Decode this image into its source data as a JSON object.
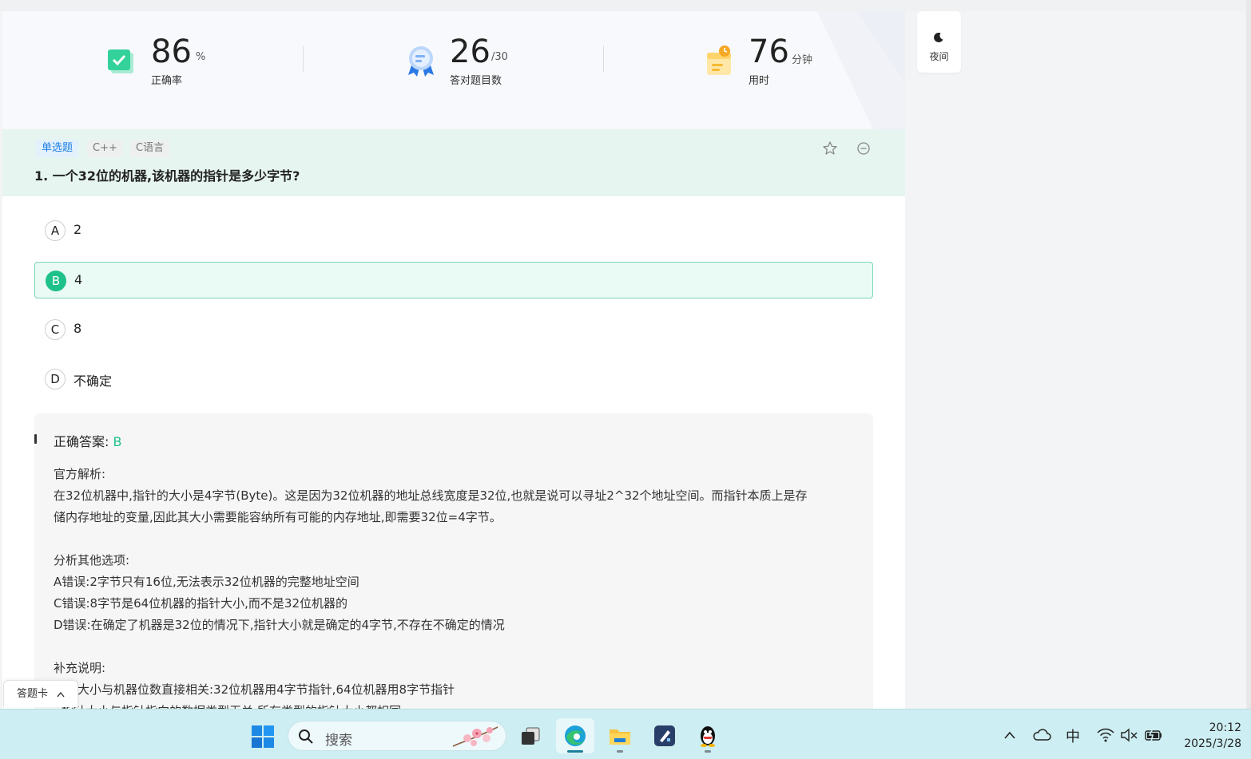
{
  "stats": [
    {
      "value": "86",
      "unit": "%",
      "label": "正确率"
    },
    {
      "value": "26",
      "unit": "/30",
      "label": "答对题目数"
    },
    {
      "value": "76",
      "unit": "分钟",
      "label": "用时"
    }
  ],
  "night_mode": {
    "label": "夜间"
  },
  "question": {
    "type_tag": "单选题",
    "tags": [
      "C++",
      "C语言"
    ],
    "title": "1. 一个32位的机器,该机器的指针是多少字节?",
    "options": [
      {
        "letter": "A",
        "text": "2",
        "selected": false
      },
      {
        "letter": "B",
        "text": "4",
        "selected": true
      },
      {
        "letter": "C",
        "text": "8",
        "selected": false
      },
      {
        "letter": "D",
        "text": "不确定",
        "selected": false
      }
    ]
  },
  "analysis": {
    "answer_label": "正确答案:",
    "answer_value": "B",
    "official_heading": "官方解析:",
    "official_line1": "在32位机器中,指针的大小是4字节(Byte)。这是因为32位机器的地址总线宽度是32位,也就是说可以寻址2^32个地址空间。而指针本质上是存",
    "official_line2": "储内存地址的变量,因此其大小需要能容纳所有可能的内存地址,即需要32位=4字节。",
    "others_heading": "分析其他选项:",
    "other_a": "A错误:2字节只有16位,无法表示32位机器的完整地址空间",
    "other_c": "C错误:8字节是64位机器的指针大小,而不是32位机器的",
    "other_d": "D错误:在确定了机器是32位的情况下,指针大小就是确定的4字节,不存在不确定的情况",
    "extra_heading": "补充说明:",
    "extra_line1": "指针大小与机器位数直接相关:32位机器用4字节指针,64位机器用8字节指针",
    "extra_line2": "- 指针大小与指针指向的数据类型无关,所有类型的指针大小都相同"
  },
  "answer_card": {
    "label": "答题卡"
  },
  "taskbar": {
    "search_placeholder": "搜索",
    "ime": "中",
    "time": "20:12",
    "date": "2025/3/28"
  },
  "colors": {
    "accent_green": "#1fc18b",
    "tag_blue": "#1f7fe8",
    "question_bg": "#e6f5f0"
  }
}
